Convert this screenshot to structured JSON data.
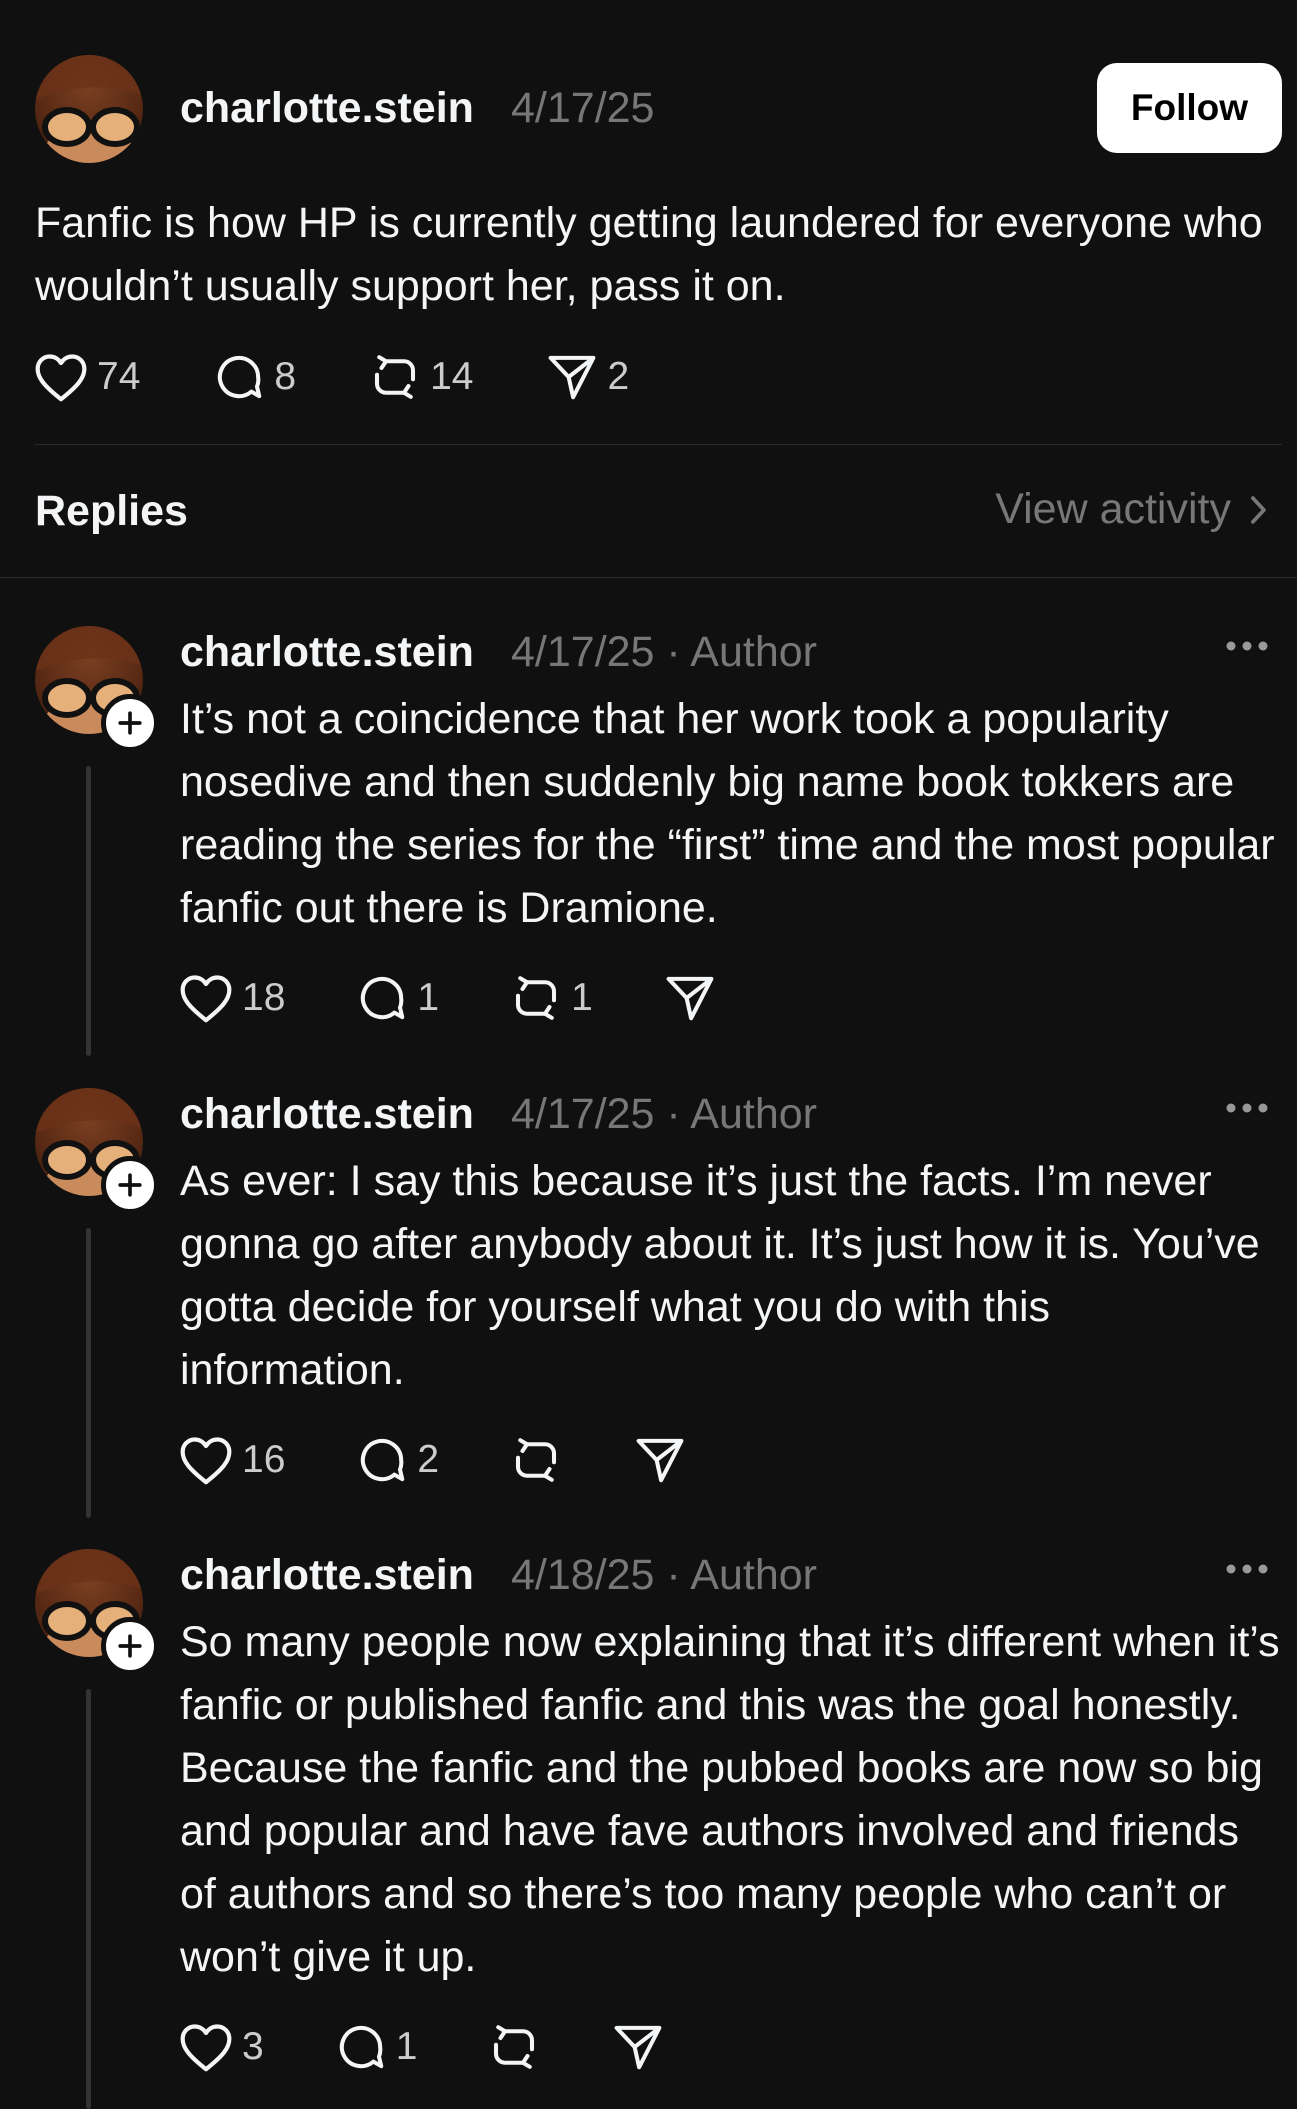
{
  "post": {
    "username": "charlotte.stein",
    "date": "4/17/25",
    "follow_label": "Follow",
    "text": "Fanfic is how HP is currently getting laundered for everyone who wouldn’t usually support her, pass it on.",
    "likes": "74",
    "comments": "8",
    "reposts": "14",
    "shares": "2"
  },
  "replies_header": {
    "title": "Replies",
    "view_activity": "View activity"
  },
  "replies": [
    {
      "username": "charlotte.stein",
      "meta": "4/17/25 · Author",
      "text": "It’s not a coincidence that her work took a popularity nosedive and then suddenly big name book tokkers are reading the series for the “first” time and the most popular fanfic out there is Dramione.",
      "likes": "18",
      "comments": "1",
      "reposts": "1"
    },
    {
      "username": "charlotte.stein",
      "meta": "4/17/25 · Author",
      "text": "As ever: I say this because it’s just the facts. I’m never gonna go after anybody about it. It’s just how it is. You’ve gotta decide for yourself what you do with this information.",
      "likes": "16",
      "comments": "2"
    },
    {
      "username": "charlotte.stein",
      "meta": "4/18/25 · Author",
      "text": "So many people now explaining that it’s different when it’s fanfic or published fanfic and this was the goal honestly. Because the fanfic and the pubbed books are now so big and popular and have fave authors involved and friends of authors and so there’s too many people who can’t or won’t give it up.",
      "likes": "3",
      "comments": "1"
    }
  ],
  "icons": {
    "like": "heart-icon",
    "comment": "comment-bubble-icon",
    "repost": "repost-icon",
    "share": "send-icon",
    "more": "more-dots-icon",
    "follow_badge": "plus-icon",
    "chevron": "chevron-right-icon"
  },
  "colors": {
    "background": "#101010",
    "text_primary": "#f3f5f7",
    "text_secondary": "#777777",
    "follow_button_bg": "#ffffff",
    "divider": "#2b2b2b"
  }
}
